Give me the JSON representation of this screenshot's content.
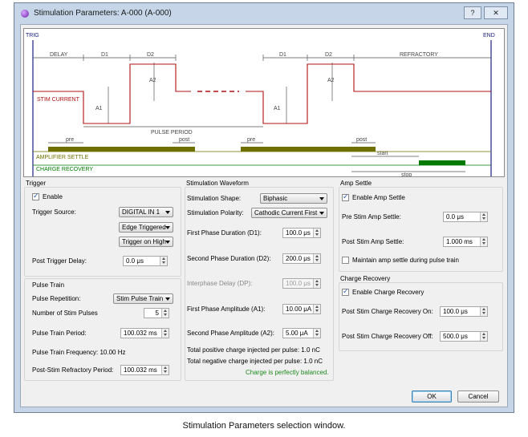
{
  "window": {
    "title": "Stimulation Parameters: A-000 (A-000)",
    "help": "?",
    "close": "✕"
  },
  "diagram": {
    "trig": "TRIG",
    "end": "END",
    "delay": "DELAY",
    "d1": "D1",
    "d2": "D2",
    "d1b": "D1",
    "d2b": "D2",
    "refractory": "REFRACTORY",
    "a2": "A2",
    "a1": "A1",
    "a2b": "A2",
    "a1b": "A1",
    "stim_current": "STIM CURRENT",
    "pulse_period": "PULSE PERIOD",
    "pre1": "pre",
    "post1": "post",
    "pre2": "pre",
    "post2": "post",
    "amp_settle": "AMPLIFIER SETTLE",
    "charge_recovery": "CHARGE RECOVERY",
    "start": "start",
    "stop": "stop",
    "colors": {
      "stim": "#b01010",
      "amp": "#6f6f00",
      "charge": "#007a00",
      "timing": "#1a2080"
    }
  },
  "trigger": {
    "title": "Trigger",
    "enable": "Enable",
    "enable_checked": true,
    "source_label": "Trigger Source:",
    "source_value": "DIGITAL IN 1",
    "edge_value": "Edge Triggered",
    "polarity_value": "Trigger on High",
    "delay_label": "Post Trigger Delay:",
    "delay_value": "0.0 μs"
  },
  "pulse_train": {
    "title": "Pulse Train",
    "repetition_label": "Pulse Repetition:",
    "repetition_value": "Stim Pulse Train",
    "num_label": "Number of Stim Pulses",
    "num_value": "5",
    "period_label": "Pulse Train Period:",
    "period_value": "100.032 ms",
    "frequency_label": "Pulse Train Frequency: 10.00 Hz",
    "refractory_label": "Post-Stim Refractory Period:",
    "refractory_value": "100.032 ms"
  },
  "waveform": {
    "title": "Stimulation Waveform",
    "shape_label": "Stimulation Shape:",
    "shape_value": "Biphasic",
    "polarity_label": "Stimulation Polarity:",
    "polarity_value": "Cathodic Current First",
    "d1_label": "First Phase Duration (D1):",
    "d1_value": "100.0 μs",
    "d2_label": "Second Phase Duration (D2):",
    "d2_value": "200.0 μs",
    "dp_label": "Interphase Delay (DP):",
    "dp_value": "100.0 μs",
    "a1_label": "First Phase Amplitude (A1):",
    "a1_value": "10.00 μA",
    "a2_label": "Second Phase Amplitude (A2):",
    "a2_value": "5.00 μA",
    "pos_charge": "Total positive charge injected per pulse: 1.0 nC",
    "neg_charge": "Total negative charge injected per pulse: 1.0 nC",
    "balanced": "Charge is perfectly balanced."
  },
  "amp_settle": {
    "title": "Amp Settle",
    "enable": "Enable Amp Settle",
    "enable_checked": true,
    "pre_label": "Pre Stim Amp Settle:",
    "pre_value": "0.0 μs",
    "post_label": "Post Stim Amp Settle:",
    "post_value": "1.000 ms",
    "maintain": "Maintain amp settle during pulse train",
    "maintain_checked": false
  },
  "charge_recovery": {
    "title": "Charge Recovery",
    "enable": "Enable Charge Recovery",
    "enable_checked": true,
    "on_label": "Post Stim Charge Recovery On:",
    "on_value": "100.0 μs",
    "off_label": "Post Stim Charge Recovery Off:",
    "off_value": "500.0 μs"
  },
  "buttons": {
    "ok": "OK",
    "cancel": "Cancel"
  },
  "caption": "Stimulation Parameters selection window."
}
